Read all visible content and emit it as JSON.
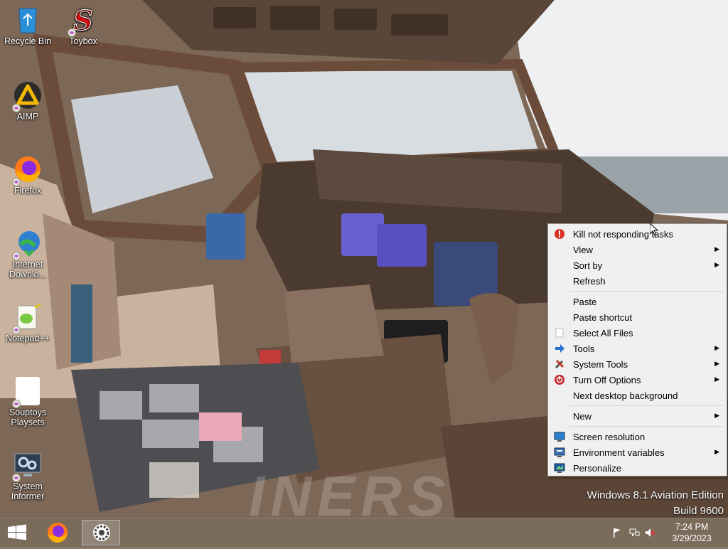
{
  "desktop_icons": [
    {
      "label": "Recycle Bin",
      "icon": "recycle-bin-icon"
    },
    {
      "label": "Toybox",
      "icon": "toybox-icon"
    },
    {
      "label": "AIMP",
      "icon": "aimp-icon"
    },
    {
      "label": "Firefox",
      "icon": "firefox-icon"
    },
    {
      "label": "Internet Downlo...",
      "icon": "internet-download-manager-icon"
    },
    {
      "label": "Notepad++",
      "icon": "notepad-plus-plus-icon"
    },
    {
      "label": "Souptoys Playsets",
      "icon": "souptoys-icon"
    },
    {
      "label": "System Informer",
      "icon": "system-informer-icon"
    }
  ],
  "context_menu": {
    "items": [
      {
        "label": "Kill not responding tasks",
        "icon": "stop-icon",
        "submenu": false
      },
      {
        "label": "View",
        "icon": "",
        "submenu": true
      },
      {
        "label": "Sort by",
        "icon": "",
        "submenu": true
      },
      {
        "label": "Refresh",
        "icon": "",
        "submenu": false
      },
      {
        "label": "Paste",
        "icon": "",
        "submenu": false
      },
      {
        "label": "Paste shortcut",
        "icon": "",
        "submenu": false
      },
      {
        "label": "Select All Files",
        "icon": "select-all-icon",
        "submenu": false
      },
      {
        "label": "Tools",
        "icon": "tools-arrow-icon",
        "submenu": true
      },
      {
        "label": "System Tools",
        "icon": "wrench-icon",
        "submenu": true
      },
      {
        "label": "Turn Off Options",
        "icon": "power-icon",
        "submenu": true
      },
      {
        "label": "Next desktop background",
        "icon": "",
        "submenu": false
      },
      {
        "label": "New",
        "icon": "",
        "submenu": true
      },
      {
        "label": "Screen resolution",
        "icon": "monitor-icon",
        "submenu": false
      },
      {
        "label": "Environment variables",
        "icon": "monitor-settings-icon",
        "submenu": true
      },
      {
        "label": "Personalize",
        "icon": "personalize-icon",
        "submenu": false
      }
    ]
  },
  "watermark": {
    "line1": "Windows 8.1 Aviation Edition",
    "line2": "Build 9600"
  },
  "taskbar": {
    "start_icon": "windows-logo-icon",
    "pinned": [
      {
        "icon": "firefox-icon",
        "active": false
      },
      {
        "icon": "settings-gear-icon",
        "active": true
      }
    ],
    "tray": [
      "flag-icon",
      "network-icon",
      "speaker-muted-icon"
    ],
    "clock": {
      "time": "7:24 PM",
      "date": "3/29/2023"
    }
  },
  "colors": {
    "menu_bg": "#f0f0f0",
    "taskbar": "#786a5a",
    "firefox_orange": "#ff7a18",
    "stop_red": "#d93025"
  }
}
